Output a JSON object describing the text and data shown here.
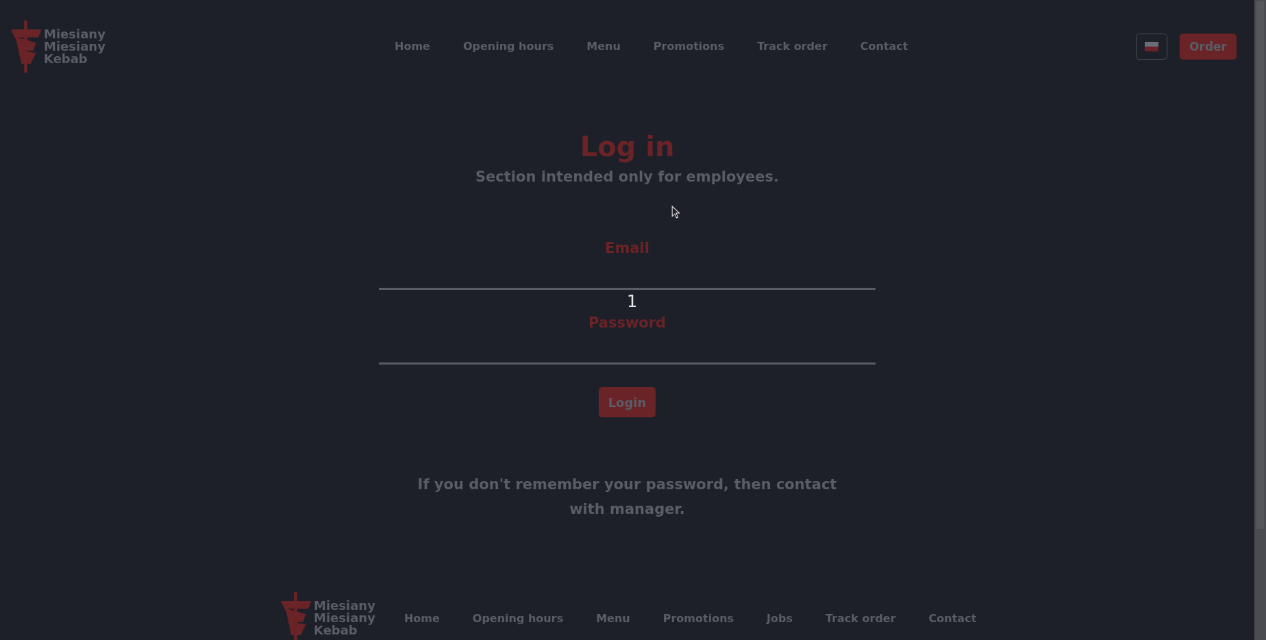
{
  "header": {
    "logo": [
      "Miesiany",
      "Miesiany",
      "Kebab"
    ],
    "nav": [
      "Home",
      "Opening hours",
      "Menu",
      "Promotions",
      "Track order",
      "Contact"
    ],
    "order_button": "Order"
  },
  "login": {
    "title": "Log in",
    "subtitle": "Section intended only for employees.",
    "fields": [
      {
        "label": "Email"
      },
      {
        "label": "Password"
      }
    ],
    "overlay_mark": "1",
    "button": "Login",
    "help": "If you don't remember your password, then contact with manager."
  },
  "footer": {
    "logo": [
      "Miesiany",
      "Miesiany",
      "Kebab"
    ],
    "nav": [
      "Home",
      "Opening hours",
      "Menu",
      "Promotions",
      "Jobs",
      "Track order",
      "Contact"
    ]
  }
}
